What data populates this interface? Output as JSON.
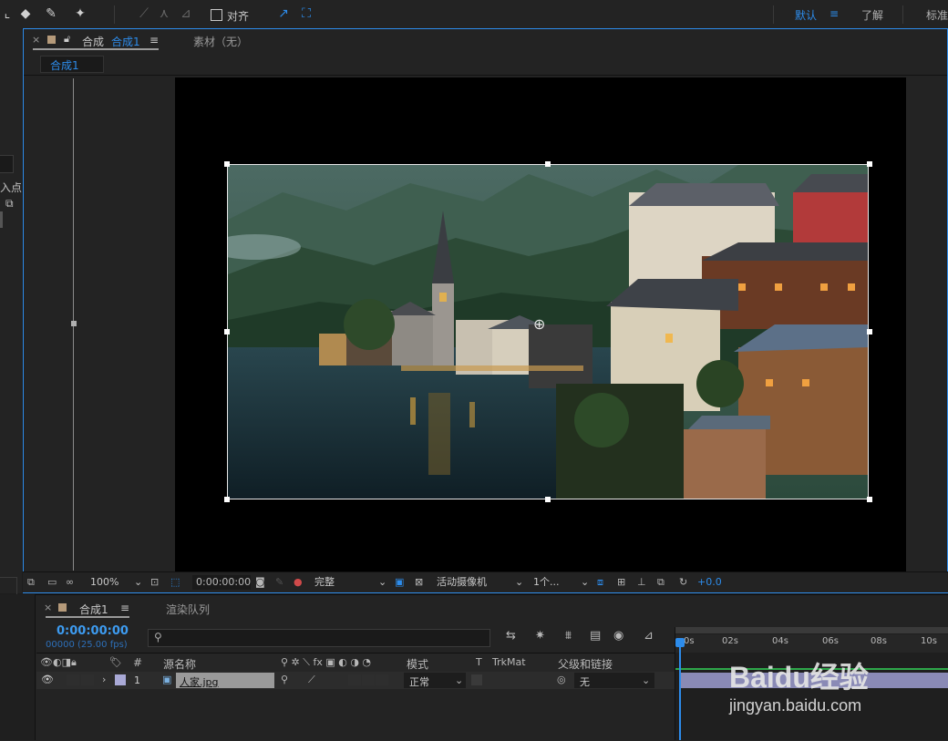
{
  "toolbar": {
    "align_label": "对齐",
    "workspace_default": "默认",
    "workspace_menu": "≡",
    "workspace_learn": "了解",
    "workspace_standard": "标准"
  },
  "left_panel": {
    "in_point_label": "入点"
  },
  "comp_panel": {
    "tab_label": "合成",
    "tab_name": "合成1",
    "tab_menu": "≡",
    "footage_tab": "素材（无）",
    "breadcrumb": "合成1"
  },
  "comp_footer": {
    "zoom": "100%",
    "timecode": "0:00:00:00",
    "resolution": "完整",
    "camera": "活动摄像机",
    "views": "1个...",
    "exposure": "+0.0"
  },
  "timeline": {
    "tab_label": "合成1",
    "tab_menu": "≡",
    "render_queue_tab": "渲染队列",
    "current_time": "0:00:00:00",
    "frame_info": "00000 (25.00 fps)",
    "search_placeholder": "",
    "columns": {
      "num": "#",
      "source_name": "源名称",
      "mode": "模式",
      "t": "T",
      "trkmat": "TrkMat",
      "parent": "父级和链接"
    },
    "ruler": [
      "0s",
      "02s",
      "04s",
      "06s",
      "08s",
      "10s"
    ],
    "layers": [
      {
        "num": "1",
        "name": "人家.jpg",
        "mode": "正常",
        "parent": "无"
      }
    ]
  },
  "watermark": {
    "brand": "Baidu经验",
    "url": "jingyan.baidu.com"
  },
  "colors": {
    "accent": "#2d8ceb",
    "layer_color": "#a9a9d6",
    "timecode": "#3d9bf0"
  }
}
